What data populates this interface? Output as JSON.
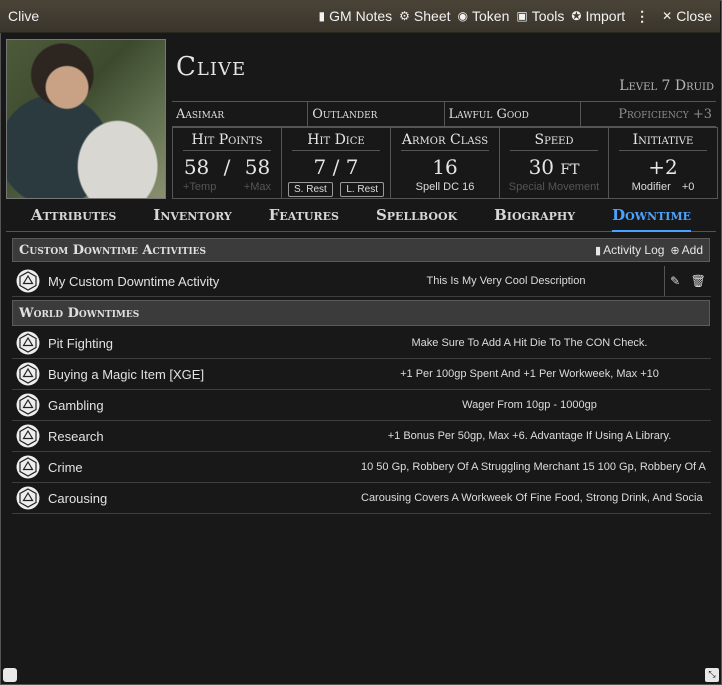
{
  "window": {
    "title": "Clive",
    "buttons": [
      {
        "label": "GM Notes",
        "icon": "clipboard-icon"
      },
      {
        "label": "Sheet",
        "icon": "gear-icon"
      },
      {
        "label": "Token",
        "icon": "user-circle-icon"
      },
      {
        "label": "Tools",
        "icon": "toolbox-icon"
      },
      {
        "label": "Import",
        "icon": "import-icon"
      }
    ],
    "close_label": "Close"
  },
  "character": {
    "name": "Clive",
    "level": "Level 7 Druid",
    "race": "Aasimar",
    "background": "Outlander",
    "alignment": "Lawful Good",
    "proficiency": "Proficiency +3"
  },
  "attributes": {
    "hp": {
      "label": "Hit Points",
      "current": "58",
      "sep": "/",
      "max": "58",
      "temp": "+Temp",
      "maxmod": "+Max"
    },
    "hit_dice": {
      "label": "Hit Dice",
      "value": "7 / 7",
      "short_rest": "S. Rest",
      "long_rest": "L. Rest"
    },
    "armor_class": {
      "label": "Armor Class",
      "value": "16",
      "sub": "Spell DC 16"
    },
    "speed": {
      "label": "Speed",
      "value": "30 ft",
      "sub": "Special Movement"
    },
    "initiative": {
      "label": "Initiative",
      "value": "+2",
      "sub_label": "Modifier",
      "sub_value": "+0"
    }
  },
  "tabs": [
    "Attributes",
    "Inventory",
    "Features",
    "Spellbook",
    "Biography",
    "Downtime"
  ],
  "active_tab": "Downtime",
  "custom_section": {
    "title": "Custom Downtime Activities",
    "activity_log": "Activity Log",
    "add": "Add",
    "items": [
      {
        "name": "My Custom Downtime Activity",
        "desc": "This Is My Very Cool Description"
      }
    ]
  },
  "world_section": {
    "title": "World Downtimes",
    "items": [
      {
        "name": "Pit Fighting",
        "desc": "Make Sure To Add A Hit Die To The CON Check."
      },
      {
        "name": "Buying a Magic Item [XGE]",
        "desc": "+1 Per 100gp Spent And +1 Per Workweek, Max +10"
      },
      {
        "name": "Gambling",
        "desc": "Wager From 10gp - 1000gp"
      },
      {
        "name": "Research",
        "desc": "+1 Bonus Per 50gp, Max +6. Advantage If Using A Library."
      },
      {
        "name": "Crime",
        "desc": "10 50 Gp, Robbery Of A Struggling Merchant 15 100 Gp, Robbery Of A"
      },
      {
        "name": "Carousing",
        "desc": "Carousing Covers A Workweek Of Fine Food, Strong Drink, And Socia"
      }
    ]
  }
}
